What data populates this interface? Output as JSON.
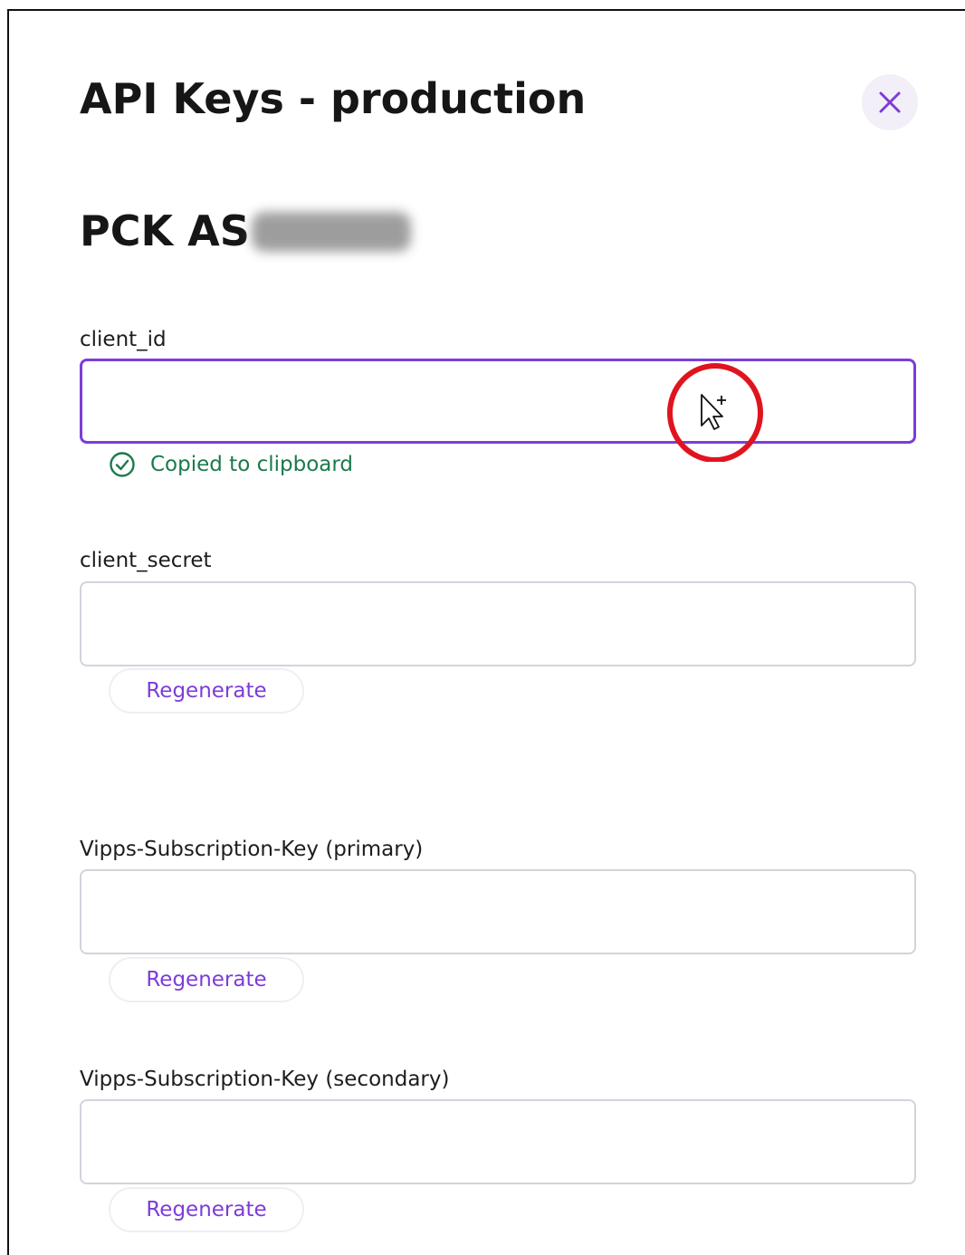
{
  "modal": {
    "title": "API Keys - production",
    "close_icon": "close-icon",
    "merchant_name": "PCK AS"
  },
  "fields": {
    "client_id": {
      "label": "client_id",
      "value": "",
      "copied_message": "Copied to clipboard"
    },
    "client_secret": {
      "label": "client_secret",
      "value": "",
      "regenerate_label": "Regenerate"
    },
    "subscription_primary": {
      "label": "Vipps-Subscription-Key (primary)",
      "value": "",
      "regenerate_label": "Regenerate"
    },
    "subscription_secondary": {
      "label": "Vipps-Subscription-Key (secondary)",
      "value": "",
      "regenerate_label": "Regenerate"
    }
  },
  "colors": {
    "accent": "#7d3cd8",
    "success": "#1a7a4b",
    "close_bg": "#f2eff8",
    "highlight_ring": "#e0141e"
  }
}
